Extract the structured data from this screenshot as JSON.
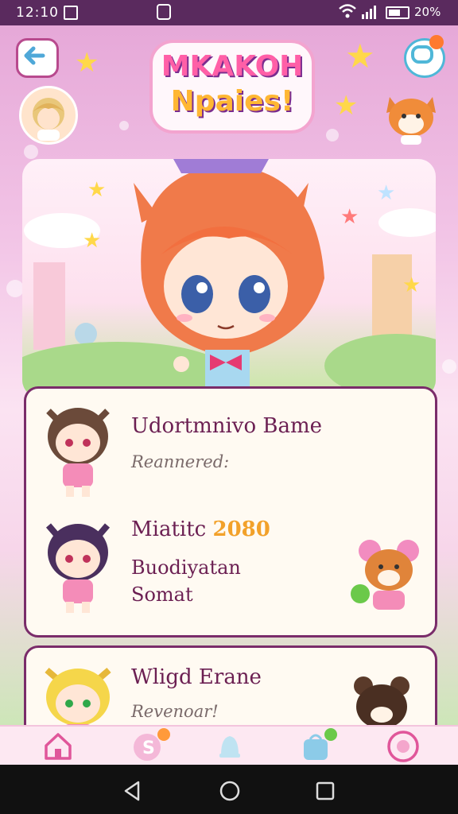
{
  "status_bar": {
    "time": "12:10",
    "battery": "20%"
  },
  "app": {
    "logo_line1": "MKAKOH",
    "logo_line2": "Npaies!"
  },
  "list": [
    {
      "title": "Udortmnivo Bame",
      "subtitle": "Reannered:"
    },
    {
      "title": "Miatitc",
      "year": "2080",
      "line1": "Buodiyatan",
      "line2": "Somat"
    },
    {
      "title": "Wligd Erane",
      "subtitle": "Revenoar!"
    }
  ],
  "bottom_nav": {
    "items": [
      "home-icon",
      "coin-icon",
      "bell-icon",
      "bag-icon",
      "profile-icon"
    ]
  },
  "colors": {
    "accent": "#b84a8e",
    "card_border": "#7a2c6a",
    "title": "#6b1f52",
    "badge": "#ff7a2f"
  }
}
